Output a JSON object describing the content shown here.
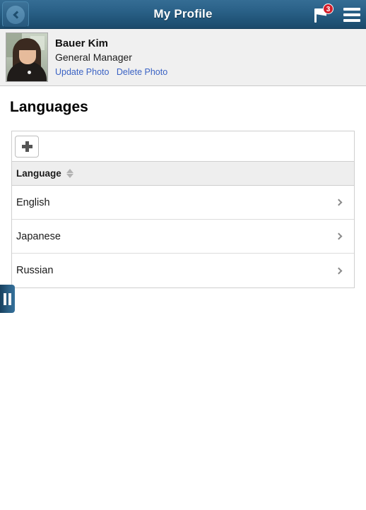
{
  "header": {
    "title": "My Profile",
    "back_icon": "chevron-left-icon",
    "notifications_icon": "flag-icon",
    "notifications_count": "3",
    "menu_icon": "hamburger-menu-icon"
  },
  "profile": {
    "name": "Bauer Kim",
    "job_title": "General Manager",
    "update_photo_label": "Update Photo",
    "delete_photo_label": "Delete Photo",
    "avatar_alt": "employee-photo"
  },
  "section": {
    "title": "Languages"
  },
  "grid": {
    "add_button_icon": "plus-icon",
    "column_header": "Language",
    "sort_icon": "sort-diamond-icon",
    "rows": [
      {
        "language": "English",
        "chevron": "chevron-right-icon"
      },
      {
        "language": "Japanese",
        "chevron": "chevron-right-icon"
      },
      {
        "language": "Russian",
        "chevron": "chevron-right-icon"
      }
    ]
  },
  "panel_toggle": {
    "icon": "panel-toggle-icon"
  },
  "colors": {
    "header_blue": "#2b6289",
    "badge_red": "#d31e2b",
    "link_blue": "#3b63c4",
    "row_border": "#dcdcdc",
    "grid_header_bg": "#eeeeee"
  }
}
